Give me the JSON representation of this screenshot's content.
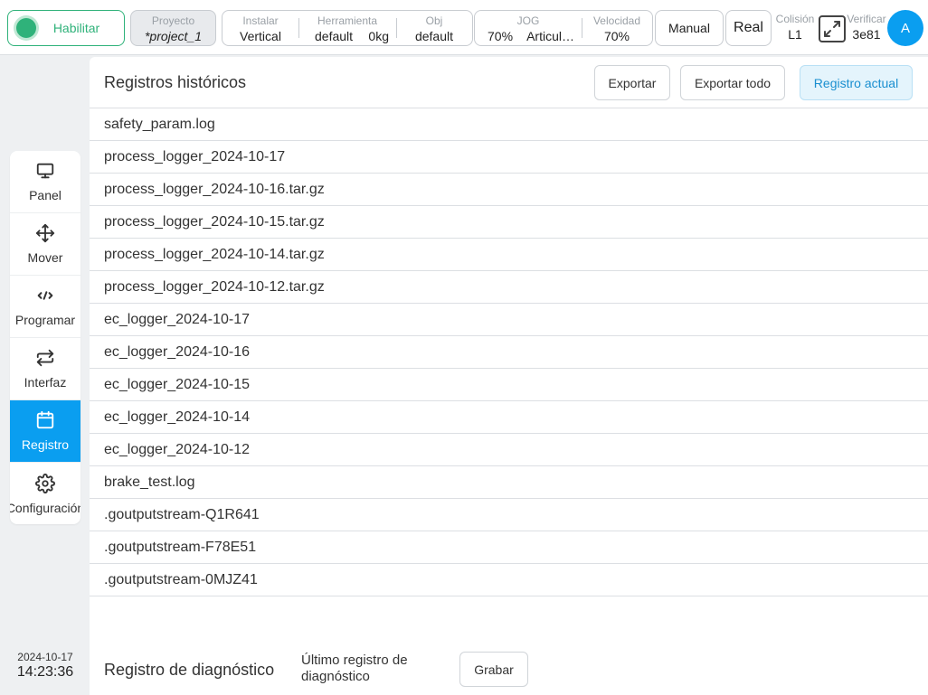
{
  "topbar": {
    "enable": {
      "label": "Habilitar",
      "color": "#2fb27a"
    },
    "project": {
      "label": "Proyecto",
      "value": "*project_1"
    },
    "install": {
      "label": "Instalar",
      "value": "Vertical"
    },
    "tool": {
      "label": "Herramienta",
      "name": "default",
      "weight": "0kg"
    },
    "obj": {
      "label": "Obj",
      "value": "default"
    },
    "jog": {
      "label": "JOG",
      "speed": "70%",
      "mode": "Articul…"
    },
    "velocity": {
      "label": "Velocidad",
      "value": "70%"
    },
    "manual_label": "Manual",
    "real_label": "Real",
    "collision": {
      "label": "Colisión",
      "value": "L1"
    },
    "verify": {
      "label": "Verificar",
      "value": "3e81"
    },
    "avatar_letter": "A",
    "accent": "#0a9ef0"
  },
  "sidebar": {
    "items": [
      {
        "label": "Panel",
        "icon": "monitor-icon"
      },
      {
        "label": "Mover",
        "icon": "move-arrows-icon"
      },
      {
        "label": "Programar",
        "icon": "code-icon"
      },
      {
        "label": "Interfaz",
        "icon": "swap-arrows-icon"
      },
      {
        "label": "Registro",
        "icon": "calendar-icon",
        "active": true
      },
      {
        "label": "Configuración",
        "icon": "gear-icon"
      }
    ]
  },
  "clock": {
    "date": "2024-10-17",
    "time": "14:23:36"
  },
  "main": {
    "title": "Registros históricos",
    "buttons": {
      "export": "Exportar",
      "export_all": "Exportar todo",
      "current_log": "Registro actual"
    },
    "logs": [
      "safety_param.log",
      "process_logger_2024-10-17",
      "process_logger_2024-10-16.tar.gz",
      "process_logger_2024-10-15.tar.gz",
      "process_logger_2024-10-14.tar.gz",
      "process_logger_2024-10-12.tar.gz",
      "ec_logger_2024-10-17",
      "ec_logger_2024-10-16",
      "ec_logger_2024-10-15",
      "ec_logger_2024-10-14",
      "ec_logger_2024-10-12",
      "brake_test.log",
      ".goutputstream-Q1R641",
      ".goutputstream-F78E51",
      ".goutputstream-0MJZ41"
    ],
    "diagnostic": {
      "title": "Registro de diagnóstico",
      "last_label": "Último registro de diagnóstico",
      "record_label": "Grabar"
    }
  }
}
